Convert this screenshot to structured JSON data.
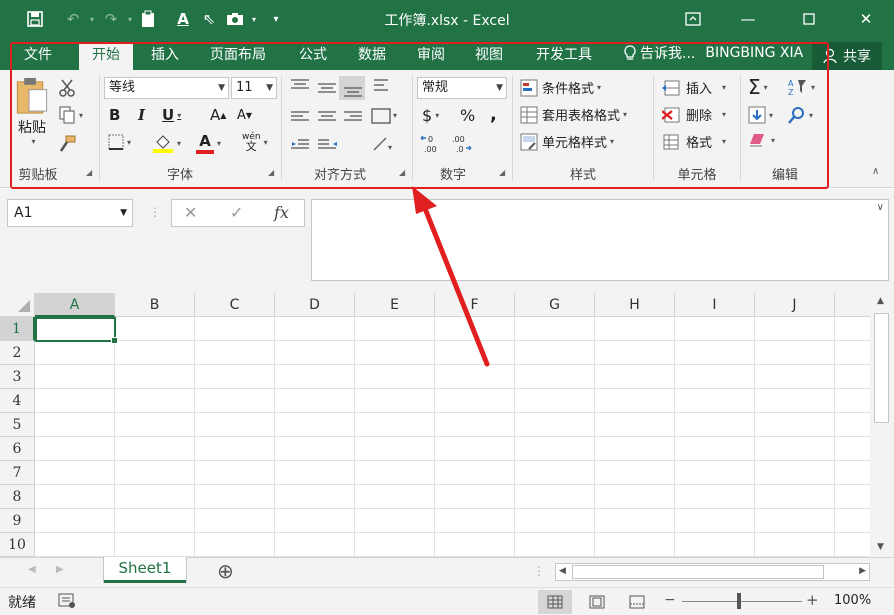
{
  "title": "工作簿.xlsx - Excel",
  "qat": {
    "customize_icon": "▾"
  },
  "tabs": [
    "文件",
    "开始",
    "插入",
    "页面布局",
    "公式",
    "数据",
    "审阅",
    "视图",
    "开发工具"
  ],
  "active_tab": "开始",
  "tell_me": "告诉我...",
  "user": "BINGBING XIA",
  "share": "共享",
  "ribbon": {
    "clipboard": {
      "paste": "粘贴",
      "label": "剪贴板"
    },
    "font": {
      "name": "等线",
      "size": "11",
      "bold": "B",
      "italic": "I",
      "underline": "U",
      "grow": "A",
      "shrink": "A",
      "color_letter": "A",
      "pinyin": "wén",
      "label": "字体"
    },
    "alignment": {
      "label": "对齐方式"
    },
    "number": {
      "format": "常规",
      "currency": "$",
      "percent": "%",
      "comma": ",",
      "label": "数字"
    },
    "styles": {
      "conditional": "条件格式",
      "table": "套用表格格式",
      "cell": "单元格样式",
      "label": "样式"
    },
    "cells": {
      "insert": "插入",
      "delete": "删除",
      "format": "格式",
      "label": "单元格"
    },
    "editing": {
      "label": "编辑"
    }
  },
  "formula_bar": {
    "name_box": "A1",
    "cancel": "✕",
    "enter": "✓",
    "fx": "fx",
    "content": ""
  },
  "columns": [
    "A",
    "B",
    "C",
    "D",
    "E",
    "F",
    "G",
    "H",
    "I",
    "J"
  ],
  "rows": [
    "1",
    "2",
    "3",
    "4",
    "5",
    "6",
    "7",
    "8",
    "9",
    "10"
  ],
  "sheet": {
    "name": "Sheet1",
    "add": "⊕"
  },
  "status": {
    "ready": "就绪",
    "zoom": "100%"
  },
  "colors": {
    "accent": "#217346",
    "highlight": "#e02020"
  }
}
